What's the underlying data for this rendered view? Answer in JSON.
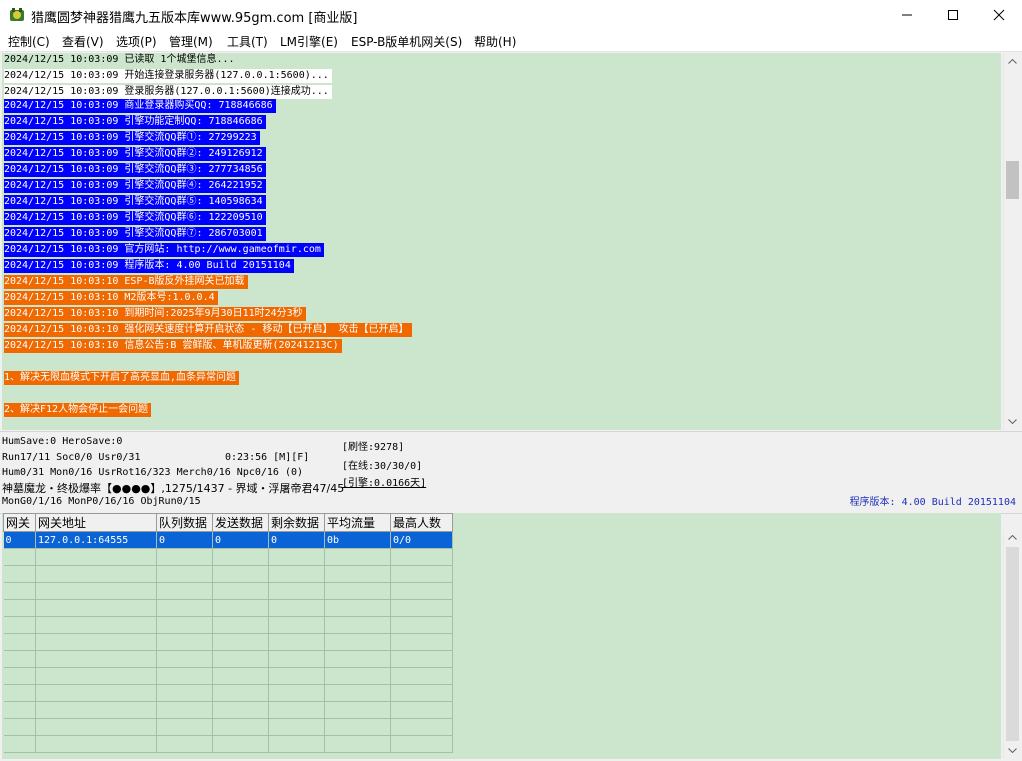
{
  "window": {
    "title": "猎鹰圆梦神器猎鹰九五版本库www.95gm.com [商业版]",
    "icon": "app-icon"
  },
  "menu": [
    "控制(C)",
    "查看(V)",
    "选项(P)",
    "管理(M)",
    "工具(T)",
    "LM引擎(E)",
    "ESP-B版单机网关(S)",
    "帮助(H)"
  ],
  "colors": {
    "log_bg": "#cbe6cc",
    "highlight_blue": "#0000ff",
    "highlight_orange": "#f06800",
    "highlight_white": "#ffffff",
    "selection": "#0a64d6",
    "version_text": "#1e2fb8"
  },
  "log": [
    {
      "text": "2024/12/15 10:03:09 已读取 1个城堡信息...",
      "style": "plain"
    },
    {
      "text": "2024/12/15 10:03:09 开始连接登录服务器(127.0.0.1:5600)...",
      "style": "white"
    },
    {
      "text": "2024/12/15 10:03:09 登录服务器(127.0.0.1:5600)连接成功...",
      "style": "white"
    },
    {
      "text": "2024/12/15 10:03:09 商业登录器购买QQ: 718846686",
      "style": "blue"
    },
    {
      "text": "2024/12/15 10:03:09 引擎功能定制QQ: 718846686",
      "style": "blue"
    },
    {
      "text": "2024/12/15 10:03:09 引擎交流QQ群①: 27299223",
      "style": "blue"
    },
    {
      "text": "2024/12/15 10:03:09 引擎交流QQ群②: 249126912",
      "style": "blue"
    },
    {
      "text": "2024/12/15 10:03:09 引擎交流QQ群③: 277734856",
      "style": "blue"
    },
    {
      "text": "2024/12/15 10:03:09 引擎交流QQ群④: 264221952",
      "style": "blue"
    },
    {
      "text": "2024/12/15 10:03:09 引擎交流QQ群⑤: 140598634",
      "style": "blue"
    },
    {
      "text": "2024/12/15 10:03:09 引擎交流QQ群⑥: 122209510",
      "style": "blue"
    },
    {
      "text": "2024/12/15 10:03:09 引擎交流QQ群⑦: 286703001",
      "style": "blue"
    },
    {
      "text": "2024/12/15 10:03:09 官方网站: http://www.gameofmir.com",
      "style": "blue"
    },
    {
      "text": "2024/12/15 10:03:09 程序版本: 4.00 Build 20151104",
      "style": "blue"
    },
    {
      "text": "2024/12/15 10:03:10 ESP-B版反外挂网关已加载",
      "style": "orange"
    },
    {
      "text": "2024/12/15 10:03:10 M2版本号:1.0.0.4",
      "style": "orange"
    },
    {
      "text": "2024/12/15 10:03:10 到期时间:2025年9月30日11时24分3秒",
      "style": "orange"
    },
    {
      "text": "2024/12/15 10:03:10 强化网关速度计算开启状态 - 移动【已开启】 攻击【已开启】",
      "style": "orange"
    },
    {
      "text": "2024/12/15 10:03:10 信息公告:B 尝鲜版、单机版更新(20241213C)",
      "style": "orange"
    },
    {
      "text": "",
      "style": "plain"
    },
    {
      "text": "1、解决无限血模式下开启了高亮显血,血条异常问题",
      "style": "orange"
    },
    {
      "text": "",
      "style": "plain"
    },
    {
      "text": "2、解决F12人物会停止一会问题",
      "style": "orange"
    }
  ],
  "status": {
    "line1": "HumSave:0 HeroSave:0",
    "line2a": "Run17/11 Soc0/0 Usr0/31",
    "line2b": "0:23:56 [M][F]",
    "line3": "Hum0/31 Mon0/16 UsrRot16/323 Merch0/16 Npc0/16 (0)",
    "line4": "神墓魔龙・终极爆率【●●●●】,1275/1437 - 界域・浮屠帝君47/45",
    "line5": "MonG0/1/16 MonP0/16/16 ObjRun0/15",
    "refresh": "[刷怪:9278]",
    "online": "[在线:30/30/0]",
    "engine": "[引擎:0.0166天]",
    "version": "程序版本: 4.00 Build 20151104"
  },
  "gateway": {
    "columns": [
      "网关",
      "网关地址",
      "队列数据",
      "发送数据",
      "剩余数据",
      "平均流量",
      "最高人数"
    ],
    "rows": [
      [
        "0",
        "127.0.0.1:64555",
        "0",
        "0",
        "0",
        "0b",
        "0/0"
      ]
    ]
  }
}
